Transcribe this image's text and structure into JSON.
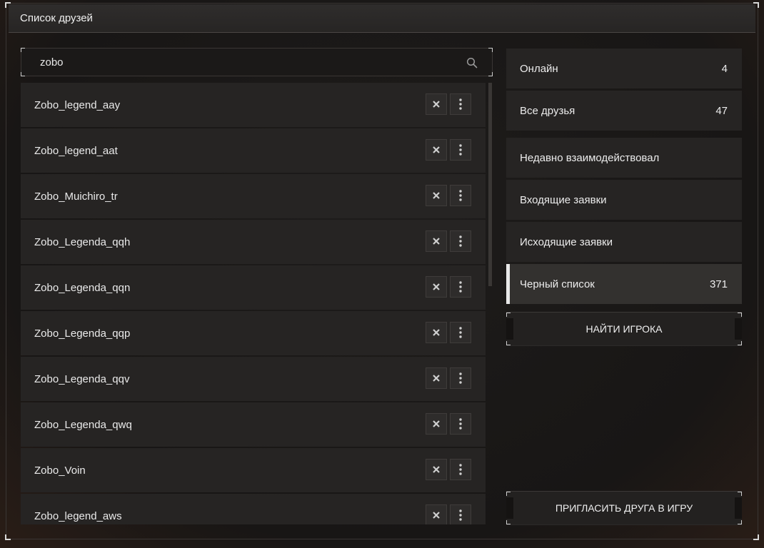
{
  "window": {
    "title": "Список друзей"
  },
  "search": {
    "value": "zobo",
    "icon": "search-icon"
  },
  "friends": [
    {
      "name": "Zobo_legend_aay"
    },
    {
      "name": "Zobo_legend_aat"
    },
    {
      "name": "Zobo_Muichiro_tr"
    },
    {
      "name": "Zobo_Legenda_qqh"
    },
    {
      "name": "Zobo_Legenda_qqn"
    },
    {
      "name": "Zobo_Legenda_qqp"
    },
    {
      "name": "Zobo_Legenda_qqv"
    },
    {
      "name": "Zobo_Legenda_qwq"
    },
    {
      "name": "Zobo_Voin"
    },
    {
      "name": "Zobo_legend_aws"
    }
  ],
  "categories": [
    {
      "label": "Онлайн",
      "count": "4"
    },
    {
      "label": "Все друзья",
      "count": "47"
    },
    {
      "label": "Недавно взаимодействовал",
      "count": ""
    },
    {
      "label": "Входящие заявки",
      "count": ""
    },
    {
      "label": "Исходящие заявки",
      "count": ""
    },
    {
      "label": "Черный список",
      "count": "371",
      "active": true
    }
  ],
  "actions": {
    "find_player": "НАЙТИ ИГРОКА",
    "invite_friend": "ПРИГЛАСИТЬ ДРУГА В ИГРУ"
  },
  "colors": {
    "accent": "#e8e8e8",
    "panel": "#262423",
    "background": "#181615"
  }
}
